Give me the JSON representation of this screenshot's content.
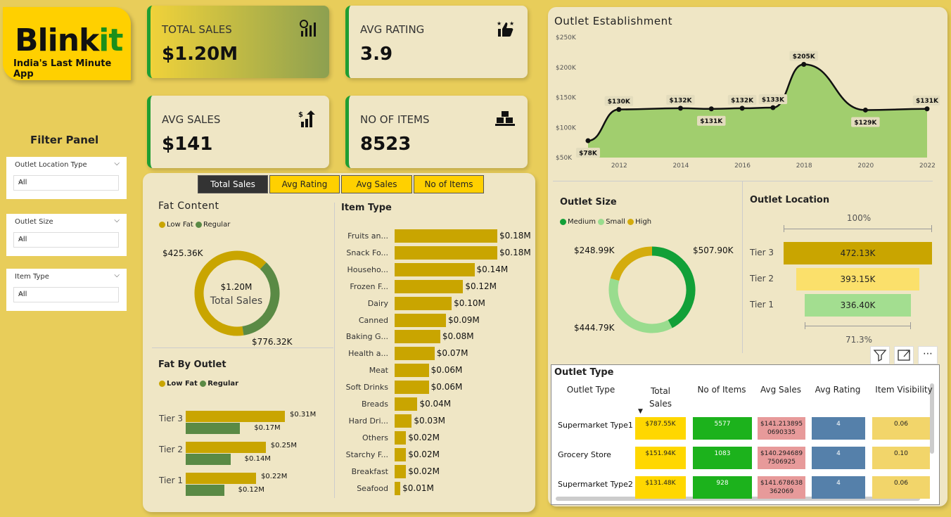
{
  "logo": {
    "name_main": "Blink",
    "name_accent": "it",
    "tagline": "India's Last Minute App"
  },
  "kpis": [
    {
      "label": "TOTAL SALES",
      "value": "$1.20M",
      "icon": "sales-chart-icon"
    },
    {
      "label": "AVG RATING",
      "value": "3.9",
      "icon": "thumbs-up-icon"
    },
    {
      "label": "AVG SALES",
      "value": "$141",
      "icon": "growth-chart-icon"
    },
    {
      "label": "NO OF ITEMS",
      "value": "8523",
      "icon": "items-boxes-icon"
    }
  ],
  "filter_panel": {
    "title": "Filter Panel",
    "slicers": [
      {
        "label": "Outlet Location Type",
        "value": "All"
      },
      {
        "label": "Outlet Size",
        "value": "All"
      },
      {
        "label": "Item Type",
        "value": "All"
      }
    ]
  },
  "tabs": [
    "Total Sales",
    "Avg Rating",
    "Avg Sales",
    "No of Items"
  ],
  "colors": {
    "low_fat": "#C9A500",
    "regular": "#5A8A45",
    "medium": "#12A038",
    "small": "#99DC8E",
    "high": "#D4AC0D"
  },
  "fat_content": {
    "title": "Fat Content",
    "legend": [
      "Low Fat",
      "Regular"
    ],
    "center_value": "$1.20M",
    "center_label": "Total Sales",
    "labels": [
      "$425.36K",
      "$776.32K"
    ]
  },
  "item_type": {
    "title": "Item Type",
    "labels": [
      "Fruits an...",
      "Snack Fo...",
      "Househo...",
      "Frozen F...",
      "Dairy",
      "Canned",
      "Baking G...",
      "Health a...",
      "Meat",
      "Soft Drinks",
      "Breads",
      "Hard Dri...",
      "Others",
      "Starchy F...",
      "Breakfast",
      "Seafood"
    ],
    "value_labels": [
      "$0.18M",
      "$0.18M",
      "$0.14M",
      "$0.12M",
      "$0.10M",
      "$0.09M",
      "$0.08M",
      "$0.07M",
      "$0.06M",
      "$0.06M",
      "$0.04M",
      "$0.03M",
      "$0.02M",
      "$0.02M",
      "$0.02M",
      "$0.01M"
    ]
  },
  "fat_by_outlet": {
    "title": "Fat By Outlet",
    "legend": [
      "Low Fat",
      "Regular"
    ],
    "tiers": [
      {
        "name": "Tier 3",
        "low": "$0.31M",
        "reg": "$0.17M"
      },
      {
        "name": "Tier 2",
        "low": "$0.25M",
        "reg": "$0.14M"
      },
      {
        "name": "Tier 1",
        "low": "$0.22M",
        "reg": "$0.12M"
      }
    ]
  },
  "outlet_size": {
    "title": "Outlet Size",
    "legend": [
      "Medium",
      "Small",
      "High"
    ],
    "labels": [
      "$507.90K",
      "$444.79K",
      "$248.99K"
    ]
  },
  "outlet_location": {
    "title": "Outlet Location",
    "top_pct": "100%",
    "bottom_pct": "71.3%",
    "tiers": [
      {
        "name": "Tier 3",
        "value": "472.13K"
      },
      {
        "name": "Tier 2",
        "value": "393.15K"
      },
      {
        "name": "Tier 1",
        "value": "336.40K"
      }
    ]
  },
  "outlet_type": {
    "title": "Outlet Type",
    "headers": [
      "Outlet Type",
      "Total Sales",
      "No of Items",
      "Avg Sales",
      "Avg Rating",
      "Item Visibility"
    ],
    "rows": [
      {
        "type": "Supermarket Type1",
        "sales": "$787.55K",
        "items": "5577",
        "avg": "$141.213895 0690335",
        "rating": "4",
        "vis": "0.06"
      },
      {
        "type": "Grocery Store",
        "sales": "$151.94K",
        "items": "1083",
        "avg": "$140.294689 7506925",
        "rating": "4",
        "vis": "0.10"
      },
      {
        "type": "Supermarket Type2",
        "sales": "$131.48K",
        "items": "928",
        "avg": "$141.678638 362069",
        "rating": "4",
        "vis": "0.06"
      }
    ]
  },
  "chart_data": [
    {
      "type": "area",
      "title": "Outlet Establishment",
      "x": [
        2011,
        2012,
        2014,
        2015,
        2016,
        2017,
        2018,
        2020,
        2022
      ],
      "values": [
        78,
        130,
        132,
        131,
        132,
        133,
        205,
        129,
        131
      ],
      "value_labels": [
        "$78K",
        "$130K",
        "$132K",
        "$131K",
        "$132K",
        "$133K",
        "$205K",
        "$129K",
        "$131K"
      ],
      "xticks": [
        "2012",
        "2014",
        "2016",
        "2018",
        "2020",
        "2022"
      ],
      "yticks": [
        "$50K",
        "$100K",
        "$150K",
        "$200K",
        "$250K"
      ],
      "ylim": [
        50,
        250
      ]
    },
    {
      "type": "pie",
      "title": "Fat Content",
      "categories": [
        "Low Fat",
        "Regular"
      ],
      "values": [
        776.32,
        425.36
      ]
    },
    {
      "type": "bar",
      "title": "Item Type",
      "values": [
        0.18,
        0.18,
        0.14,
        0.12,
        0.1,
        0.09,
        0.08,
        0.07,
        0.06,
        0.06,
        0.04,
        0.03,
        0.02,
        0.02,
        0.02,
        0.01
      ]
    },
    {
      "type": "bar",
      "title": "Fat By Outlet",
      "categories": [
        "Tier 3",
        "Tier 2",
        "Tier 1"
      ],
      "series": [
        {
          "name": "Low Fat",
          "values": [
            0.31,
            0.25,
            0.22
          ]
        },
        {
          "name": "Regular",
          "values": [
            0.17,
            0.14,
            0.12
          ]
        }
      ]
    },
    {
      "type": "pie",
      "title": "Outlet Size",
      "categories": [
        "Medium",
        "Small",
        "High"
      ],
      "values": [
        507.9,
        444.79,
        248.99
      ]
    },
    {
      "type": "bar",
      "title": "Outlet Location",
      "categories": [
        "Tier 3",
        "Tier 2",
        "Tier 1"
      ],
      "values": [
        472.13,
        393.15,
        336.4
      ]
    }
  ]
}
